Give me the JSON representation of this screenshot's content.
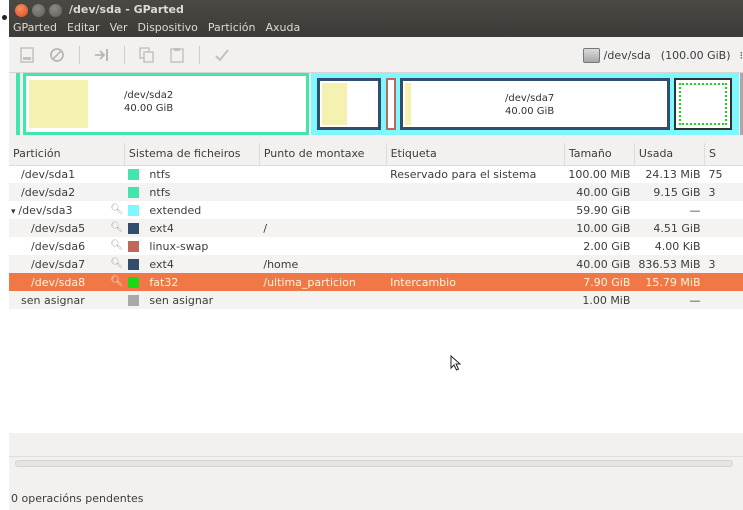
{
  "window": {
    "title": "/dev/sda - GParted"
  },
  "menu": [
    "GParted",
    "Editar",
    "Ver",
    "Dispositivo",
    "Partición",
    "Axuda"
  ],
  "toolbar": {
    "device": "/dev/sda",
    "size": "(100.00 GiB)"
  },
  "partmap": [
    {
      "name": "/dev/sda2",
      "size": "40.00 GiB"
    },
    {
      "name": "/dev/sda7",
      "size": "40.00 GiB"
    }
  ],
  "columns": [
    "Partición",
    "Sistema de ficheiros",
    "Punto de montaxe",
    "Etiqueta",
    "Tamaño",
    "Usada",
    "S"
  ],
  "rows": [
    {
      "partition": "/dev/sda1",
      "fs": "ntfs",
      "color": "#42e5ac",
      "mount": "",
      "label": "Reservado para el sistema",
      "size": "100.00 MiB",
      "used": "24.13 MiB",
      "rest": "75",
      "key": false,
      "alt": false
    },
    {
      "partition": "/dev/sda2",
      "fs": "ntfs",
      "color": "#42e5ac",
      "mount": "",
      "label": "",
      "size": "40.00 GiB",
      "used": "9.15 GiB",
      "rest": "3",
      "key": false,
      "alt": true
    },
    {
      "partition": "/dev/sda3",
      "fs": "extended",
      "color": "#7df8ff",
      "mount": "",
      "label": "",
      "size": "59.90 GiB",
      "used": "—",
      "rest": "",
      "key": true,
      "alt": false,
      "expanded": true
    },
    {
      "partition": "/dev/sda5",
      "fs": "ext4",
      "color": "#314e6c",
      "mount": "/",
      "label": "",
      "size": "10.00 GiB",
      "used": "4.51 GiB",
      "rest": "",
      "key": true,
      "alt": true,
      "indent": true
    },
    {
      "partition": "/dev/sda6",
      "fs": "linux-swap",
      "color": "#c1665a",
      "mount": "",
      "label": "",
      "size": "2.00 GiB",
      "used": "4.00 KiB",
      "rest": "",
      "key": true,
      "alt": false,
      "indent": true
    },
    {
      "partition": "/dev/sda7",
      "fs": "ext4",
      "color": "#314e6c",
      "mount": "/home",
      "label": "",
      "size": "40.00 GiB",
      "used": "836.53 MiB",
      "rest": "3",
      "key": true,
      "alt": true,
      "indent": true
    },
    {
      "partition": "/dev/sda8",
      "fs": "fat32",
      "color": "#18d918",
      "mount": "/ultima_particion",
      "label": "Intercambio",
      "size": "7.90 GiB",
      "used": "15.79 MiB",
      "rest": "",
      "key": true,
      "alt": false,
      "indent": true,
      "selected": true
    },
    {
      "partition": "sen asignar",
      "fs": "sen asignar",
      "color": "#a9a9a9",
      "mount": "",
      "label": "",
      "size": "1.00 MiB",
      "used": "—",
      "rest": "",
      "key": false,
      "alt": true
    }
  ],
  "status": "0 operacións pendentes"
}
